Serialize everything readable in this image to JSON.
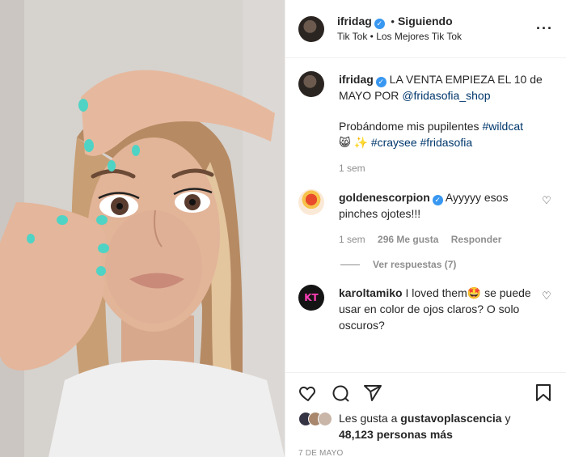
{
  "header": {
    "username": "ifridag",
    "separator": "•",
    "follow_status": "Siguiendo",
    "audio": "Tik Tok • Los Mejores Tik Tok",
    "more_icon": "more-horizontal-icon"
  },
  "caption": {
    "username": "ifridag",
    "text_part1": "LA VENTA EMPIEZA EL 10 de MAYO POR ",
    "mention": "@fridasofia_shop",
    "line2_text": "Probándome mis pupilentes ",
    "hashtag1": "#wildcat",
    "emoji": "😸 ✨",
    "hashtag2": "#craysee",
    "hashtag3": "#fridasofia",
    "time": "1 sem"
  },
  "comments": [
    {
      "username": "goldenescorpion",
      "text": "Ayyyyy esos pinches ojotes!!!",
      "time": "1 sem",
      "likes": "296 Me gusta",
      "reply": "Responder",
      "view_replies": "Ver respuestas (7)"
    },
    {
      "username": "karoltamiko",
      "text": "I loved them🤩 se puede usar en color de ojos claros? O solo oscuros?",
      "avatar_text": "KT"
    }
  ],
  "likes": {
    "prefix": "Les gusta a ",
    "user": "gustavoplascencia",
    "mid": " y ",
    "count": "48,123 personas más"
  },
  "date": "7 DE MAYO",
  "colors": {
    "link": "#00376b",
    "verified": "#3897f0",
    "muted": "#8e8e8e",
    "nail": "#4fd3c4"
  }
}
